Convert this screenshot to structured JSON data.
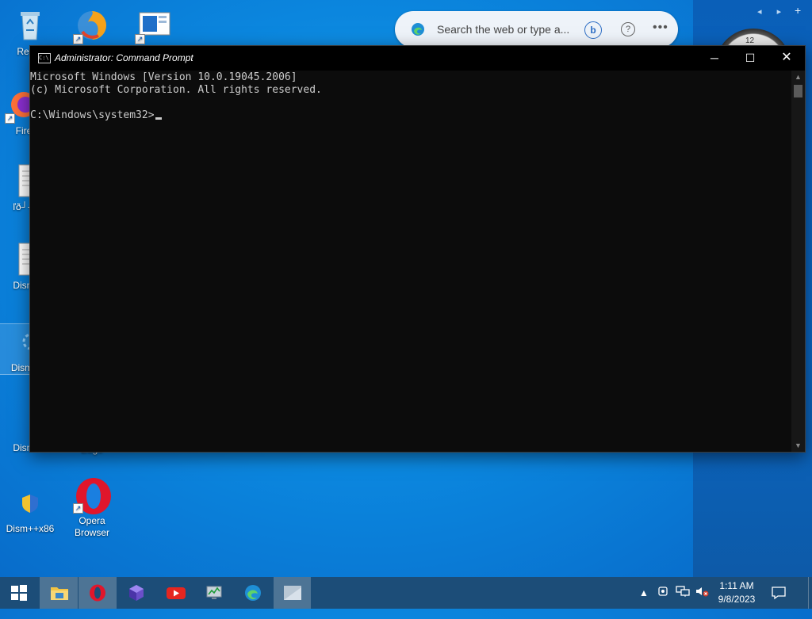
{
  "desktop_icons": [
    {
      "name": "recycle-bin",
      "label": "Recyc"
    },
    {
      "name": "firefox",
      "label": "Fire"
    },
    {
      "name": "file-1",
      "label": "ľð┘┐"
    },
    {
      "name": "dism-file",
      "label": "Dism"
    },
    {
      "name": "dism-gear-1",
      "label": "Dism+"
    },
    {
      "name": "dism-2",
      "label": "Dism"
    },
    {
      "name": "dism-x86",
      "label": "Dism++x86"
    },
    {
      "name": "edge-desktop",
      "label": "Edge"
    },
    {
      "name": "opera",
      "label": "Opera Browser"
    }
  ],
  "search": {
    "placeholder": "Search the web or type a..."
  },
  "cmd_window": {
    "title": "Administrator: Command Prompt",
    "lines": [
      "Microsoft Windows [Version 10.0.19045.2006]",
      "(c) Microsoft Corporation. All rights reserved.",
      "",
      "C:\\Windows\\system32>"
    ]
  },
  "gadget": {
    "clock_number": "12"
  },
  "taskbar": {
    "items": [
      {
        "name": "start",
        "icon": "windows-icon"
      },
      {
        "name": "file-explorer",
        "icon": "folder-icon"
      },
      {
        "name": "opera",
        "icon": "opera-icon"
      },
      {
        "name": "app-purple",
        "icon": "purple-app-icon"
      },
      {
        "name": "youtube",
        "icon": "youtube-icon"
      },
      {
        "name": "task-manager",
        "icon": "monitor-chart-icon"
      },
      {
        "name": "edge",
        "icon": "edge-icon"
      },
      {
        "name": "cmd-window",
        "icon": "window-icon"
      }
    ],
    "time": "1:11 AM",
    "date": "9/8/2023"
  },
  "colors": {
    "taskbar": "#1c4d78",
    "console_bg": "#0c0c0c",
    "console_text": "#cccccc"
  }
}
